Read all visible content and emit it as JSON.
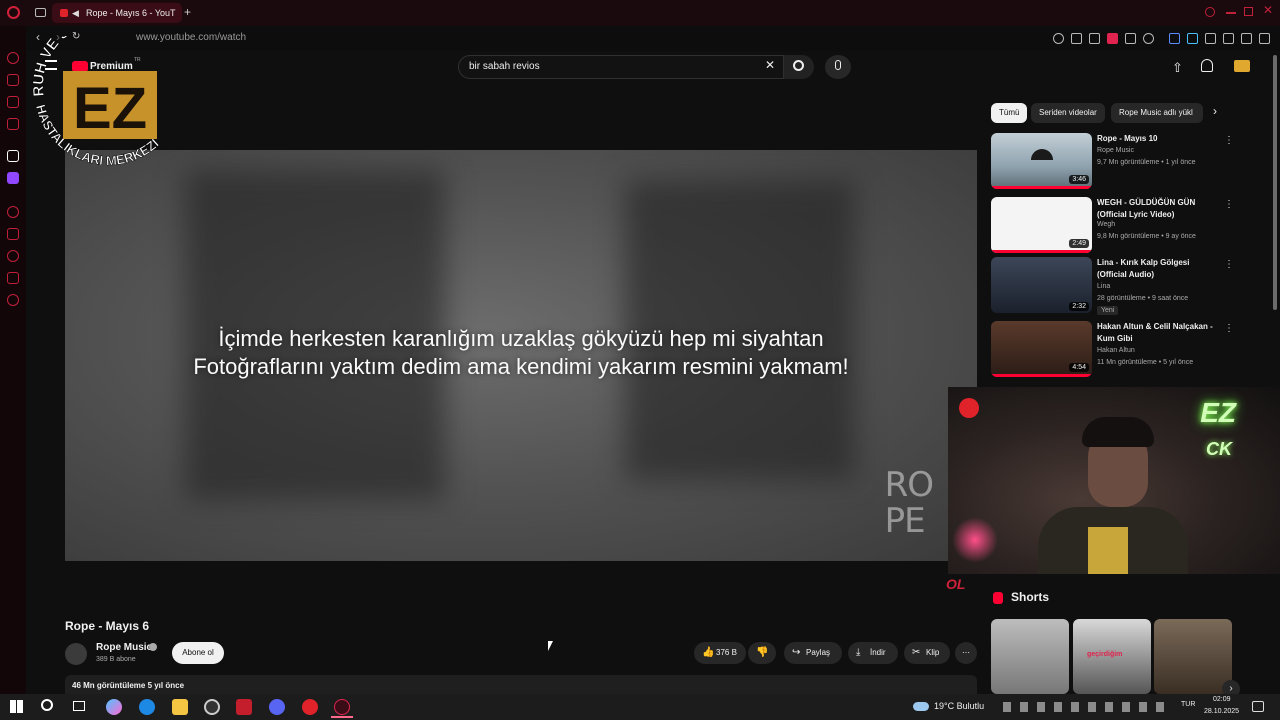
{
  "browser": {
    "tab_title": "Rope - Mayıs 6 - YouT",
    "new_tab_symbol": "+",
    "url": "www.youtube.com/watch"
  },
  "youtube": {
    "logo_text": "Premium",
    "logo_sup": "TR",
    "search_value": "bir sabah revios",
    "chips": [
      "Tümü",
      "Seriden videolar",
      "Rope Music adlı yükl"
    ],
    "video": {
      "title": "Rope - Mayıs 6",
      "lyric_line1": "İçimde herkesten karanlığım uzaklaş gökyüzü hep mi siyahtan",
      "lyric_line2": "Fotoğraflarını yaktım dedim ama kendimi yakarım resmini yakmam!",
      "watermark_top": "RO",
      "watermark_bottom": "PE",
      "channel_name": "Rope Music",
      "channel_subs": "389 B abone",
      "subscribe_label": "Abone ol",
      "likes": "376 B",
      "share_label": "Paylaş",
      "download_label": "İndir",
      "clip_label": "Klip",
      "views_date": "46 Mn görüntüleme  5 yıl önce"
    },
    "recommendations": [
      {
        "title": "Rope - Mayıs 10",
        "channel": "Rope Music",
        "meta": "9,7 Mn görüntüleme • 1 yıl önce",
        "duration": "3:46",
        "thumb_color": "#a9b9c3"
      },
      {
        "title": "WEGH - GÜLDÜĞÜN GÜN (Official Lyric Video)",
        "channel": "Wegh",
        "meta": "9,8 Mn görüntüleme • 9 ay önce",
        "duration": "2:49",
        "thumb_color": "#f4f4f4"
      },
      {
        "title": "Lina - Kırık Kalp Gölgesi (Official Audio)",
        "channel": "Lina",
        "meta": "28 görüntüleme • 9 saat önce",
        "duration": "2:32",
        "badge": "Yeni",
        "thumb_color": "#2d3441"
      },
      {
        "title": "Hakan Altun & Celil Nalçakan - Kum Gibi",
        "channel": "Hakan Altun",
        "meta": "11 Mn görüntüleme • 5 yıl önce",
        "duration": "4:54",
        "thumb_color": "#3c2a22"
      }
    ],
    "shorts_label": "Shorts",
    "shorts_caption": "geçirdiğim"
  },
  "overlay": {
    "arc_top": "RUH VE SİNİR",
    "arc_bottom": "HASTALIKLARI MERKEZİ",
    "logo_letters": "EZ",
    "webcam_neon_logo": "EZ",
    "webcam_neon_sub": "CK",
    "corner_logo": "OL"
  },
  "taskbar": {
    "weather": "19°C  Bulutlu",
    "language": "TUR",
    "time": "02:09",
    "date": "28.10.2025"
  }
}
